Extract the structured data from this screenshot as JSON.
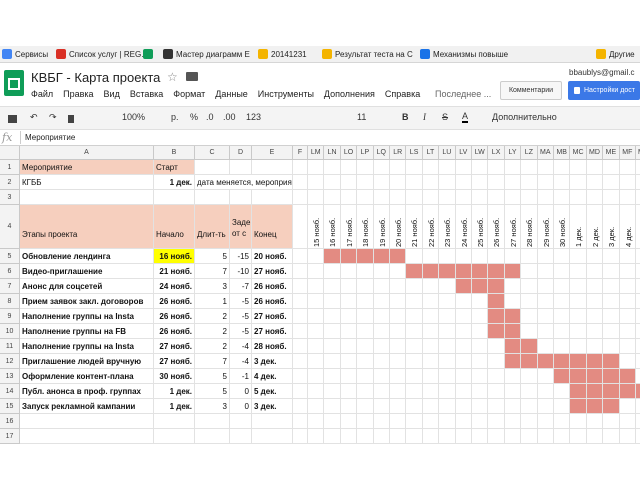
{
  "bookmarks": [
    {
      "label": "Сервисы",
      "color": "#4285f4"
    },
    {
      "label": "Список услуг | REG.R",
      "color": "#d93025"
    },
    {
      "label": "",
      "color": "#0f9d58"
    },
    {
      "label": "Мастер диаграмм Е",
      "color": "#333333"
    },
    {
      "label": "20141231",
      "color": "#f4b400"
    },
    {
      "label": "Результат теста на С",
      "color": "#f4b400"
    },
    {
      "label": "Механизмы повыше",
      "color": "#1a73e8"
    },
    {
      "label": "Другие",
      "color": "#f4b400"
    }
  ],
  "doc": {
    "title": "КВБГ - Карта проекта",
    "user": "bbaublys@gmail.c",
    "menu": [
      "Файл",
      "Правка",
      "Вид",
      "Вставка",
      "Формат",
      "Данные",
      "Инструменты",
      "Дополнения",
      "Справка"
    ],
    "last_edit": "Последнее ...",
    "comments_label": "Комментарии",
    "share_label": "Настройки дост"
  },
  "toolbar": {
    "zoom": "100%",
    "currency": "р.",
    "percent": "%",
    "dec_down": ".0",
    "dec_up": ".00",
    "format": "123",
    "font_size": "11",
    "bold": "B",
    "italic": "I",
    "strike": "S",
    "textcolor": "A",
    "more": "Дополнительно"
  },
  "formula": {
    "fx": "fx",
    "value": "Мероприятие"
  },
  "columns": [
    "A",
    "B",
    "C",
    "D",
    "E",
    "F",
    "LM",
    "LN",
    "LO",
    "LP",
    "LQ",
    "LR",
    "LS",
    "LT",
    "LU",
    "LV",
    "LW",
    "LX",
    "LY",
    "LZ",
    "MA",
    "MB",
    "MC",
    "MD",
    "ME",
    "MF",
    "MG"
  ],
  "rows": [
    {
      "num": "1",
      "a": "Мероприятие",
      "b": "Старт",
      "c": "",
      "d": "",
      "e": ""
    },
    {
      "num": "2",
      "a": "КГББ",
      "b": "1 дек.",
      "c": "дата меняется, мероприятия",
      "d": "",
      "e": ""
    },
    {
      "num": "3",
      "a": "",
      "b": "",
      "c": "",
      "d": "",
      "e": ""
    },
    {
      "num": "4",
      "a": "Этапы проекта",
      "b": "Начало",
      "c": "Длит-ть",
      "d": "Заде от с",
      "e": "Конец"
    },
    {
      "num": "5",
      "a": "Обновление лендинга",
      "b": "16 нояб.",
      "c": "5",
      "d": "-15",
      "e": "20 нояб."
    },
    {
      "num": "6",
      "a": "Видео-приглашение",
      "b": "21 нояб.",
      "c": "7",
      "d": "-10",
      "e": "27 нояб."
    },
    {
      "num": "7",
      "a": "Анонс для соцсетей",
      "b": "24 нояб.",
      "c": "3",
      "d": "-7",
      "e": "26 нояб."
    },
    {
      "num": "8",
      "a": "Прием заявок закл. договоров",
      "b": "26 нояб.",
      "c": "1",
      "d": "-5",
      "e": "26 нояб."
    },
    {
      "num": "9",
      "a": "Наполнение группы на Insta",
      "b": "26 нояб.",
      "c": "2",
      "d": "-5",
      "e": "27 нояб."
    },
    {
      "num": "10",
      "a": "Наполнение группы на FB",
      "b": "26 нояб.",
      "c": "2",
      "d": "-5",
      "e": "27 нояб."
    },
    {
      "num": "11",
      "a": "Наполнение группы на Insta",
      "b": "27 нояб.",
      "c": "2",
      "d": "-4",
      "e": "28 нояб."
    },
    {
      "num": "12",
      "a": "Приглашение людей вручную",
      "b": "27 нояб.",
      "c": "7",
      "d": "-4",
      "e": "3 дек."
    },
    {
      "num": "13",
      "a": "Оформление контент-плана",
      "b": "30 нояб.",
      "c": "5",
      "d": "-1",
      "e": "4 дек."
    },
    {
      "num": "14",
      "a": "Публ. анонса в проф. группах",
      "b": "1 дек.",
      "c": "5",
      "d": "0",
      "e": "5 дек."
    },
    {
      "num": "15",
      "a": "Запуск рекламной кампании",
      "b": "1 дек.",
      "c": "3",
      "d": "0",
      "e": "3 дек."
    },
    {
      "num": "16",
      "a": "",
      "b": "",
      "c": "",
      "d": "",
      "e": ""
    },
    {
      "num": "17",
      "a": "",
      "b": "",
      "c": "",
      "d": "",
      "e": ""
    }
  ],
  "timeline_dates": [
    "15 нояб.",
    "16 нояб.",
    "17 нояб.",
    "18 нояб.",
    "19 нояб.",
    "20 нояб.",
    "21 нояб.",
    "22 нояб.",
    "23 нояб.",
    "24 нояб.",
    "25 нояб.",
    "26 нояб.",
    "27 нояб.",
    "28 нояб.",
    "29 нояб.",
    "30 нояб.",
    "1 дек.",
    "2 дек.",
    "3 дек.",
    "4 дек.",
    "5 дек."
  ],
  "gantt": [
    {
      "row": 5,
      "start": 1,
      "len": 5
    },
    {
      "row": 6,
      "start": 6,
      "len": 7
    },
    {
      "row": 7,
      "start": 9,
      "len": 3
    },
    {
      "row": 8,
      "start": 11,
      "len": 1
    },
    {
      "row": 9,
      "start": 11,
      "len": 2
    },
    {
      "row": 10,
      "start": 11,
      "len": 2
    },
    {
      "row": 11,
      "start": 12,
      "len": 2
    },
    {
      "row": 12,
      "start": 12,
      "len": 7
    },
    {
      "row": 13,
      "start": 15,
      "len": 5
    },
    {
      "row": 14,
      "start": 16,
      "len": 5
    },
    {
      "row": 15,
      "start": 16,
      "len": 3
    }
  ]
}
